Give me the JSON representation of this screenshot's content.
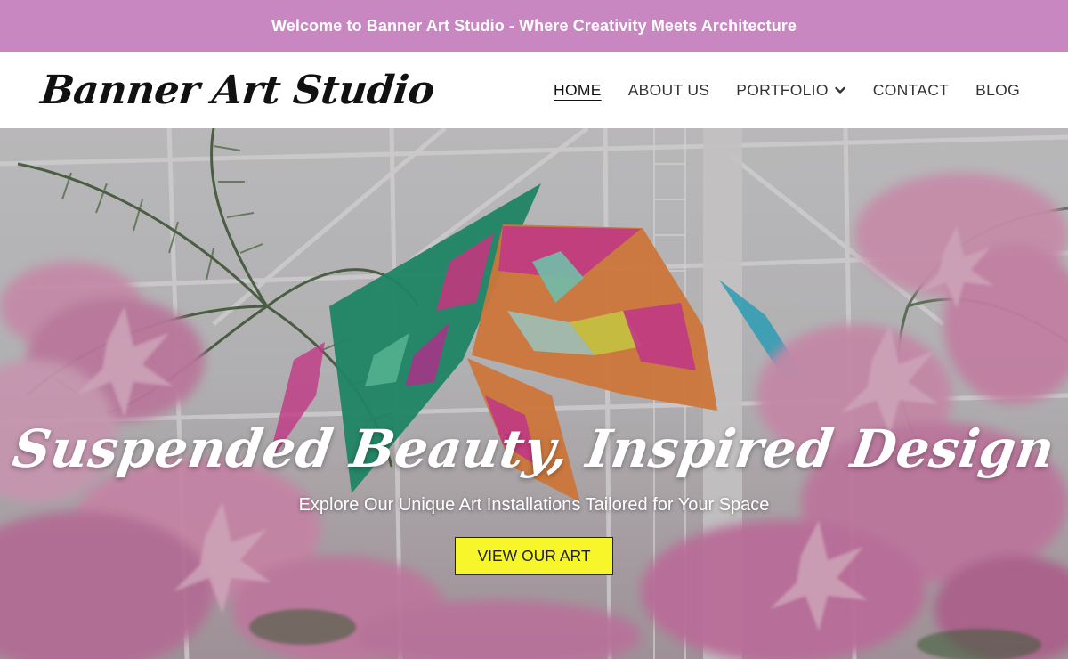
{
  "announcement": {
    "text": "Welcome to Banner Art Studio - Where Creativity Meets Architecture"
  },
  "header": {
    "logo": "Banner Art Studio",
    "nav": [
      {
        "label": "HOME",
        "active": true
      },
      {
        "label": "ABOUT US"
      },
      {
        "label": "PORTFOLIO",
        "icon": "chevron-down-icon"
      },
      {
        "label": "CONTACT"
      },
      {
        "label": "BLOG"
      }
    ]
  },
  "hero": {
    "title": "Suspended Beauty, Inspired Design",
    "subtitle": "Explore Our Unique Art Installations Tailored for Your Space",
    "cta_label": "VIEW OUR ART"
  },
  "colors": {
    "announcement_bg": "#c887c1",
    "cta_bg": "#f6f62a",
    "kite_green": "#1f9b72",
    "kite_pink": "#e0479a",
    "kite_orange": "#f08c3c",
    "flower_pink": "#e9a4c4"
  }
}
